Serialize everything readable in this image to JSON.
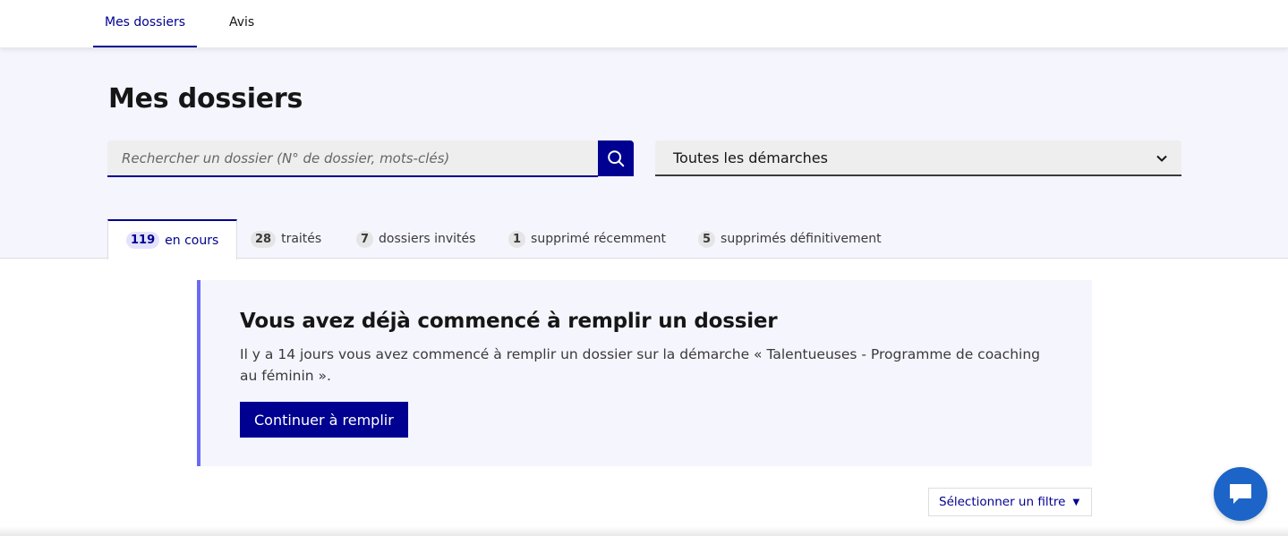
{
  "nav": {
    "items": [
      {
        "label": "Mes dossiers",
        "active": true
      },
      {
        "label": "Avis",
        "active": false
      }
    ]
  },
  "header": {
    "title": "Mes dossiers",
    "search": {
      "placeholder": "Rechercher un dossier (N° de dossier, mots-clés)",
      "value": "",
      "icon": "search-icon"
    },
    "select": {
      "selected": "Toutes les démarches",
      "icon": "chevron-down-icon"
    }
  },
  "tabs": [
    {
      "count": "119",
      "label": "en cours",
      "active": true
    },
    {
      "count": "28",
      "label": "traités",
      "active": false
    },
    {
      "count": "7",
      "label": "dossiers invités",
      "active": false
    },
    {
      "count": "1",
      "label": "supprimé récemment",
      "active": false
    },
    {
      "count": "5",
      "label": "supprimés définitivement",
      "active": false
    }
  ],
  "notice": {
    "title": "Vous avez déjà commencé à remplir un dossier",
    "text": "Il y a 14 jours vous avez commencé à remplir un dossier sur la démarche « Talentueuses - Programme de coaching au féminin ».",
    "button": "Continuer à remplir"
  },
  "filter": {
    "label": "Sélectionner un filtre",
    "icon": "caret-down-icon"
  },
  "chat": {
    "icon": "chat-bubble-icon"
  },
  "colors": {
    "primary": "#000091",
    "band": "#f5f5fe",
    "accent_border": "#6a6af4",
    "chat": "#1c64c8"
  }
}
